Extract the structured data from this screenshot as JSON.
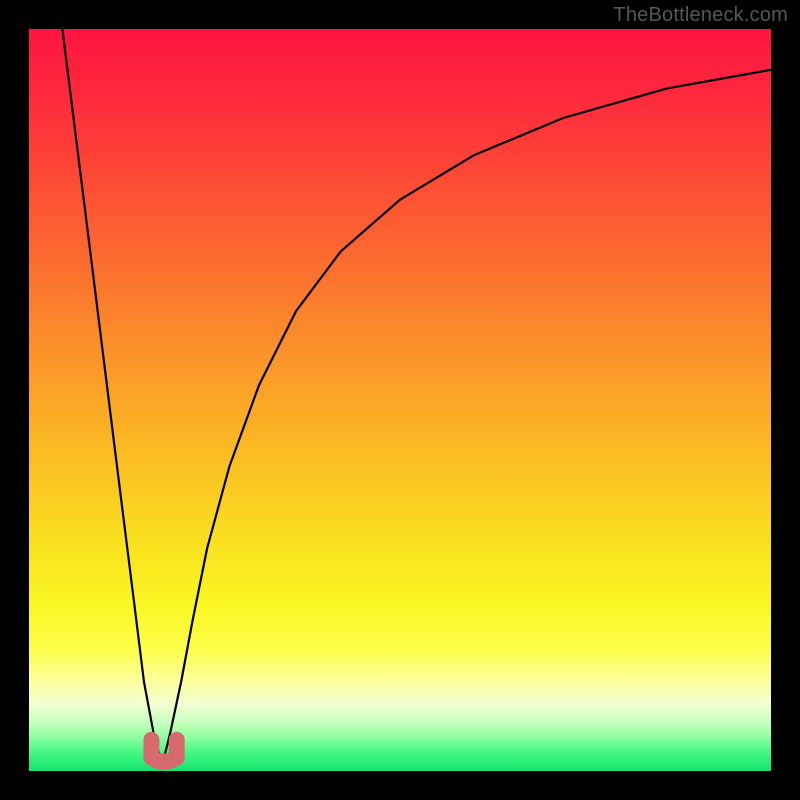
{
  "watermark": "TheBottleneck.com",
  "colors": {
    "frame": "#000000",
    "curve": "#000000",
    "marker": "#d76a6f",
    "watermark_text": "#575757"
  },
  "gradient_stops": [
    {
      "offset": 0.0,
      "color": "#fe1441"
    },
    {
      "offset": 0.1,
      "color": "#fe2c3c"
    },
    {
      "offset": 0.2,
      "color": "#fd4a35"
    },
    {
      "offset": 0.3,
      "color": "#fc6830"
    },
    {
      "offset": 0.4,
      "color": "#fb872b"
    },
    {
      "offset": 0.5,
      "color": "#faa626"
    },
    {
      "offset": 0.6,
      "color": "#fac422"
    },
    {
      "offset": 0.7,
      "color": "#f9e31e"
    },
    {
      "offset": 0.78,
      "color": "#faf724"
    },
    {
      "offset": 0.84,
      "color": "#fcff4f"
    },
    {
      "offset": 0.88,
      "color": "#fdffa0"
    },
    {
      "offset": 0.91,
      "color": "#f0ffd0"
    },
    {
      "offset": 0.935,
      "color": "#c7ffbf"
    },
    {
      "offset": 0.955,
      "color": "#8dff9f"
    },
    {
      "offset": 0.975,
      "color": "#45f884"
    },
    {
      "offset": 1.0,
      "color": "#14e36c"
    }
  ],
  "chart_data": {
    "type": "line",
    "title": "",
    "xlabel": "",
    "ylabel": "",
    "xlim": [
      0,
      100
    ],
    "ylim": [
      0,
      100
    ],
    "note": "x is a normalized parameter (0–100 across plot width); y is percent of plot height measured from bottom. Two branches of one black curve meeting at a sharp minimum near x≈18.",
    "series": [
      {
        "name": "left-branch",
        "x": [
          4.5,
          6,
          8,
          10,
          12,
          14,
          15.5,
          17,
          18
        ],
        "y": [
          100,
          88,
          72,
          56,
          40,
          24,
          12,
          4,
          1
        ]
      },
      {
        "name": "right-branch",
        "x": [
          18,
          19,
          20.5,
          22,
          24,
          27,
          31,
          36,
          42,
          50,
          60,
          72,
          86,
          100
        ],
        "y": [
          1,
          5,
          12,
          20,
          30,
          41,
          52,
          62,
          70,
          77,
          83,
          88,
          92,
          94.5
        ]
      }
    ],
    "marker": {
      "name": "minimum-marker",
      "shape": "u",
      "x_center": 18.2,
      "width_pct": 3.4,
      "y_bottom_pct": 1.0,
      "y_top_pct": 4.2,
      "color": "#d76a6f"
    }
  }
}
